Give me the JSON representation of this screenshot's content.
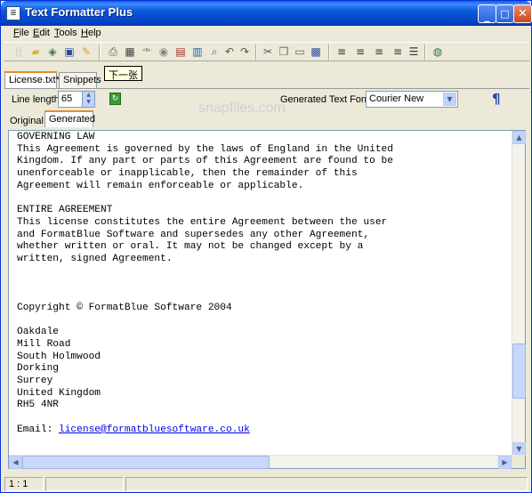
{
  "window": {
    "title": "Text Formatter Plus"
  },
  "menu": [
    {
      "label": "File",
      "key": "F",
      "rest": "ile"
    },
    {
      "label": "Edit",
      "key": "E",
      "rest": "dit"
    },
    {
      "label": "Tools",
      "key": "T",
      "rest": "ools"
    },
    {
      "label": "Help",
      "key": "H",
      "rest": "elp"
    }
  ],
  "toolbar_icons": [
    "new-file-icon",
    "open-folder-icon",
    "recent-files-icon",
    "save-icon",
    "export-icon",
    "print-icon",
    "calculator-icon",
    "spellcheck-icon",
    "cd-icon",
    "format-icon",
    "calendar-icon",
    "find-icon",
    "undo-icon",
    "redo-icon",
    "cut-icon",
    "copy-icon",
    "paste-icon",
    "paste-special-icon",
    "align-left-icon",
    "align-center-icon",
    "align-right-icon",
    "justify-icon",
    "list-icon",
    "globe-icon"
  ],
  "top_tabs": [
    {
      "label": "License.txt*"
    },
    {
      "label": "Snippets"
    }
  ],
  "tooltip": "下一张",
  "options": {
    "line_length_label": "Line length:",
    "line_length_value": "65",
    "font_label": "Generated Text Font:",
    "font_value": "Courier New",
    "pilcrow": "¶"
  },
  "inner_tabs": [
    {
      "label": "Original"
    },
    {
      "label": "Generated"
    }
  ],
  "watermark": "snapfiles.com",
  "editor": {
    "lines": [
      "GOVERNING LAW",
      "This Agreement is governed by the laws of England in the United",
      "Kingdom. If any part or parts of this Agreement are found to be",
      "unenforceable or inapplicable, then the remainder of this",
      "Agreement will remain enforceable or applicable.",
      "",
      "ENTIRE AGREEMENT",
      "This license constitutes the entire Agreement between the user",
      "and FormatBlue Software and supersedes any other Agreement,",
      "whether written or oral. It may not be changed except by a",
      "written, signed Agreement.",
      "",
      "",
      "",
      "Copyright © FormatBlue Software 2004",
      "",
      "Oakdale",
      "Mill Road",
      "South Holmwood",
      "Dorking",
      "Surrey",
      "United Kingdom",
      "RH5 4NR",
      ""
    ],
    "email_label": "Email: ",
    "email_link": "license@formatbluesoftware.co.uk",
    "vertical_scroll_position": 0.82,
    "horizontal_scroll_fraction": 0.52
  },
  "status": {
    "position": "1 : 1"
  }
}
